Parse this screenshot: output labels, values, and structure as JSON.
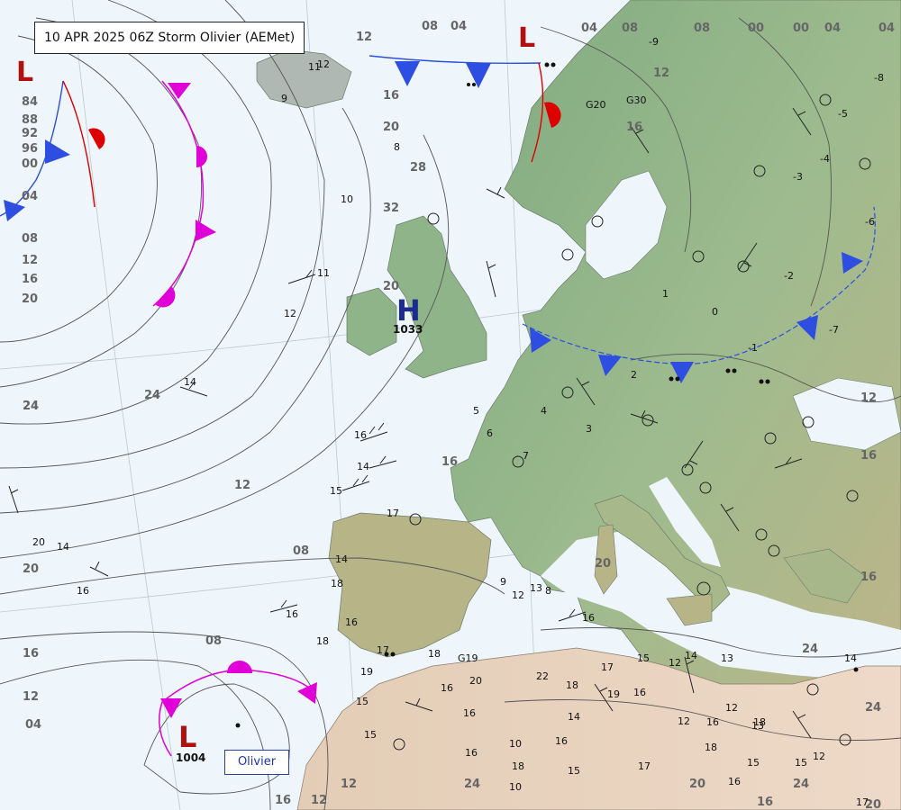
{
  "title": "10 APR 2025 06Z Storm Olivier (AEMet)",
  "storm_label": "Olivier",
  "colors": {
    "sea": "#eef6fb",
    "land_green": "#8fb48a",
    "land_brown": "#d8c6a4",
    "land_desert": "#e6cfb8",
    "isobar": "#555555",
    "warm_front": "#dd0000",
    "cold_front": "#2d4ee0",
    "occluded_front": "#e000d8",
    "low": "#b01010",
    "high": "#1b2b8f"
  },
  "pressure_centers": [
    {
      "type": "L",
      "value": ""
    },
    {
      "type": "L",
      "value": ""
    },
    {
      "type": "H",
      "value": "1033"
    },
    {
      "type": "L",
      "value": "1004"
    }
  ],
  "isobar_labels": [
    "84",
    "88",
    "92",
    "96",
    "00",
    "04",
    "08",
    "12",
    "16",
    "20",
    "08",
    "04",
    "12",
    "16",
    "20",
    "24",
    "28",
    "32",
    "20",
    "24",
    "16",
    "12",
    "08",
    "12",
    "16",
    "20",
    "24",
    "08",
    "16",
    "12",
    "04",
    "04",
    "08",
    "08",
    "00",
    "00",
    "04",
    "04",
    "12",
    "16",
    "16",
    "12",
    "16",
    "20",
    "24",
    "20",
    "24",
    "24",
    "24",
    "20",
    "16",
    "12"
  ],
  "station_values": [
    "12",
    "11",
    "8",
    "9",
    "10",
    "11",
    "12",
    "14",
    "16",
    "14",
    "15",
    "14",
    "20",
    "14",
    "16",
    "17",
    "18",
    "16",
    "18",
    "16",
    "19",
    "17",
    "18",
    "22",
    "20",
    "16",
    "15",
    "16",
    "15",
    "14",
    "16",
    "12",
    "13",
    "16",
    "17",
    "18",
    "19",
    "16",
    "15",
    "12",
    "10",
    "18",
    "16",
    "15",
    "17",
    "12",
    "16",
    "18",
    "12",
    "13",
    "15",
    "14",
    "13",
    "18",
    "15",
    "12",
    "14",
    "17",
    "16",
    "10",
    "9",
    "8",
    "7",
    "6",
    "5",
    "4",
    "3",
    "2",
    "1",
    "0",
    "-1",
    "-2",
    "-3",
    "-4",
    "-5",
    "-6",
    "-7",
    "-8",
    "-9",
    "G20",
    "G30",
    "G19"
  ]
}
